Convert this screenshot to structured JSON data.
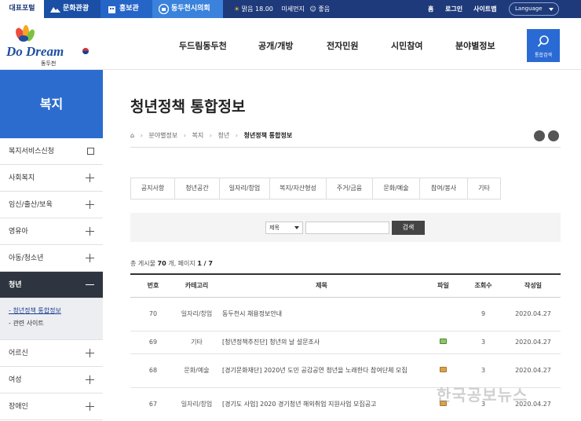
{
  "topbar": {
    "portal": "대표포털",
    "tabs": [
      {
        "label": "문화관광",
        "icon": "mountain-icon"
      },
      {
        "label": "홍보관",
        "icon": "building-icon"
      },
      {
        "label": "동두천시의회",
        "icon": "council-icon"
      }
    ],
    "weather": "맑음 18.00",
    "dust_label": "미세먼지",
    "dust_status": "좋음",
    "links": [
      "홈",
      "로그인",
      "사이트맵"
    ],
    "language": "Language"
  },
  "header": {
    "logo_text": "Do Dream",
    "logo_sub": "동두천",
    "nav": [
      "두드림동두천",
      "공개/개방",
      "전자민원",
      "시민참여",
      "분야별정보"
    ],
    "search_label": "통합검색"
  },
  "sidebar": {
    "title": "복지",
    "items": [
      {
        "label": "복지서비스신청",
        "mark": "window"
      },
      {
        "label": "사회복지",
        "mark": "plus"
      },
      {
        "label": "임신/출산/보육",
        "mark": "plus"
      },
      {
        "label": "영유아",
        "mark": "plus"
      },
      {
        "label": "아동/청소년",
        "mark": "plus"
      },
      {
        "label": "청년",
        "mark": "minus",
        "active": true
      }
    ],
    "sub_items": [
      "청년정책 통합정보",
      "관련 사이트"
    ],
    "items_after": [
      {
        "label": "어르신",
        "mark": "plus"
      },
      {
        "label": "여성",
        "mark": "plus"
      },
      {
        "label": "장애인",
        "mark": "plus"
      }
    ]
  },
  "page": {
    "title": "청년정책 통합정보",
    "breadcrumb": [
      "분야별정보",
      "복지",
      "청년",
      "청년정책 통합정보"
    ]
  },
  "tabs": [
    "공지사항",
    "청년공간",
    "일자리/창업",
    "복지/자산형성",
    "주거/금융",
    "문화/예술",
    "참여/봉사",
    "기타"
  ],
  "search": {
    "field_option": "제목",
    "button": "검색"
  },
  "count": {
    "prefix": "총 게시물",
    "total": "70",
    "unit": "개,",
    "page_label": "페이지",
    "page": "1 / 7"
  },
  "table": {
    "headers": [
      "번호",
      "카테고리",
      "제목",
      "파일",
      "조회수",
      "작성일"
    ],
    "rows": [
      {
        "no": "70",
        "category": "일자리/창업",
        "title": "동두천시 채용정보안내",
        "file": "",
        "views": "9",
        "date": "2020.04.27"
      },
      {
        "no": "69",
        "category": "기타",
        "title": "[청년정책추진단] 청년의 날 설문조사",
        "file": "image-file-icon",
        "views": "3",
        "date": "2020.04.27"
      },
      {
        "no": "68",
        "category": "문화/예술",
        "title": "[경기문화재단] 2020년 도민 공감공연 청년을 노래한다 참여단체 모집",
        "file": "folder-file-icon",
        "views": "3",
        "date": "2020.04.27"
      },
      {
        "no": "67",
        "category": "일자리/창업",
        "title": "[경기도 사업] 2020 경기청년 해외취업 지원사업 모집공고",
        "file": "folder-file-icon",
        "views": "3",
        "date": "2020.04.27"
      }
    ]
  },
  "watermark": "한국공보뉴스"
}
